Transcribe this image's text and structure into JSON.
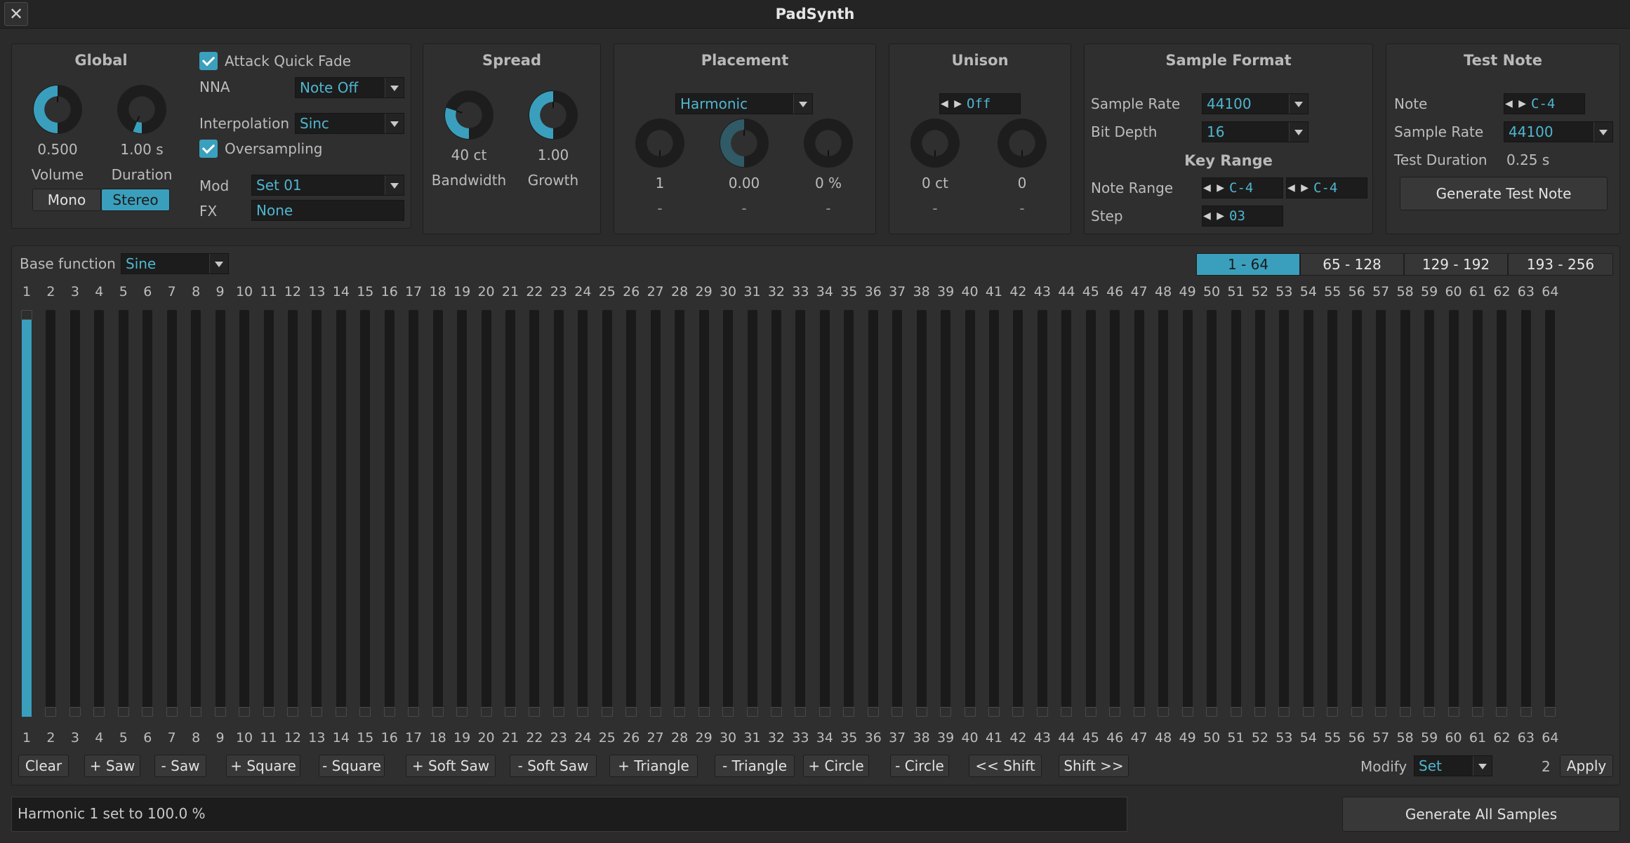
{
  "window": {
    "title": "PadSynth",
    "close_label": "✕"
  },
  "global": {
    "title": "Global",
    "volume_value": "0.500",
    "volume_label": "Volume",
    "volume_level": 0.5,
    "duration_value": "1.00 s",
    "duration_label": "Duration",
    "duration_level": 0.06,
    "mono_label": "Mono",
    "stereo_label": "Stereo",
    "attack_quick_fade_label": "Attack Quick Fade",
    "nna_label": "NNA",
    "nna_value": "Note Off",
    "interpolation_label": "Interpolation",
    "interpolation_value": "Sinc",
    "oversampling_label": "Oversampling",
    "mod_label": "Mod",
    "mod_value": "Set 01",
    "fx_label": "FX",
    "fx_value": "None"
  },
  "spread": {
    "title": "Spread",
    "bandwidth_value": "40 ct",
    "bandwidth_label": "Bandwidth",
    "bandwidth_level": 0.3,
    "growth_value": "1.00",
    "growth_label": "Growth",
    "growth_level": 0.5
  },
  "placement": {
    "title": "Placement",
    "mode_value": "Harmonic",
    "knob1_value": "1",
    "knob2_value": "0.00",
    "knob3_value": "0 %",
    "knob2_level": 0.5,
    "dash": "-"
  },
  "unison": {
    "title": "Unison",
    "voices_value": "Off",
    "detune_value": "0 ct",
    "spread_value": "0",
    "dash": "-"
  },
  "sample_format": {
    "title": "Sample Format",
    "sample_rate_label": "Sample Rate",
    "sample_rate_value": "44100",
    "bit_depth_label": "Bit Depth",
    "bit_depth_value": "16",
    "key_range_title": "Key Range",
    "note_range_label": "Note Range",
    "note_range_low": "C-4",
    "note_range_high": "C-4",
    "step_label": "Step",
    "step_value": "03"
  },
  "test_note": {
    "title": "Test Note",
    "note_label": "Note",
    "note_value": "C-4",
    "sample_rate_label": "Sample Rate",
    "sample_rate_value": "44100",
    "test_duration_label": "Test Duration",
    "test_duration_value": "0.25 s",
    "generate_label": "Generate Test Note"
  },
  "harmonics": {
    "base_function_label": "Base function",
    "base_function_value": "Sine",
    "pages": [
      "1 - 64",
      "65 - 128",
      "129 - 192",
      "193 - 256"
    ],
    "active_page": 0,
    "count": 64,
    "levels": [
      1.0,
      0,
      0,
      0,
      0,
      0,
      0,
      0,
      0,
      0,
      0,
      0,
      0,
      0,
      0,
      0,
      0,
      0,
      0,
      0,
      0,
      0,
      0,
      0,
      0,
      0,
      0,
      0,
      0,
      0,
      0,
      0,
      0,
      0,
      0,
      0,
      0,
      0,
      0,
      0,
      0,
      0,
      0,
      0,
      0,
      0,
      0,
      0,
      0,
      0,
      0,
      0,
      0,
      0,
      0,
      0,
      0,
      0,
      0,
      0,
      0,
      0,
      0,
      0
    ],
    "buttons": [
      "Clear",
      "+ Saw",
      "- Saw",
      "+ Square",
      "- Square",
      "+ Soft Saw",
      "- Soft Saw",
      "+ Triangle",
      "- Triangle",
      "+ Circle",
      "- Circle",
      "<< Shift",
      "Shift >>"
    ],
    "modify_label": "Modify",
    "modify_value": "Set",
    "apply_count": "2",
    "apply_label": "Apply"
  },
  "status": {
    "text": "Harmonic 1 set to 100.0 %"
  },
  "generate_all_label": "Generate All Samples",
  "colors": {
    "accent": "#3a9fbc",
    "background": "#2b2b2b",
    "panel": "#2f2f2f"
  }
}
